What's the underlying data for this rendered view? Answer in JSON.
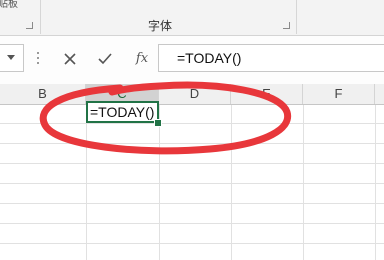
{
  "ribbon": {
    "group_label": "字体",
    "tab_fragment": "贴板"
  },
  "formula_bar": {
    "cancel_icon": "close-icon",
    "enter_icon": "check-icon",
    "function_label": "fx",
    "formula_text": "=TODAY()"
  },
  "sheet": {
    "columns": [
      "B",
      "C",
      "D",
      "E",
      "F"
    ],
    "active_column": "C",
    "active_cell_text": "=TODAY()"
  },
  "annotation": {
    "color": "#e8373b",
    "shape": "ellipse"
  },
  "colors": {
    "excel_green": "#217346",
    "header_bg": "#f0f0f0",
    "grid_line": "#e1e1e1"
  }
}
